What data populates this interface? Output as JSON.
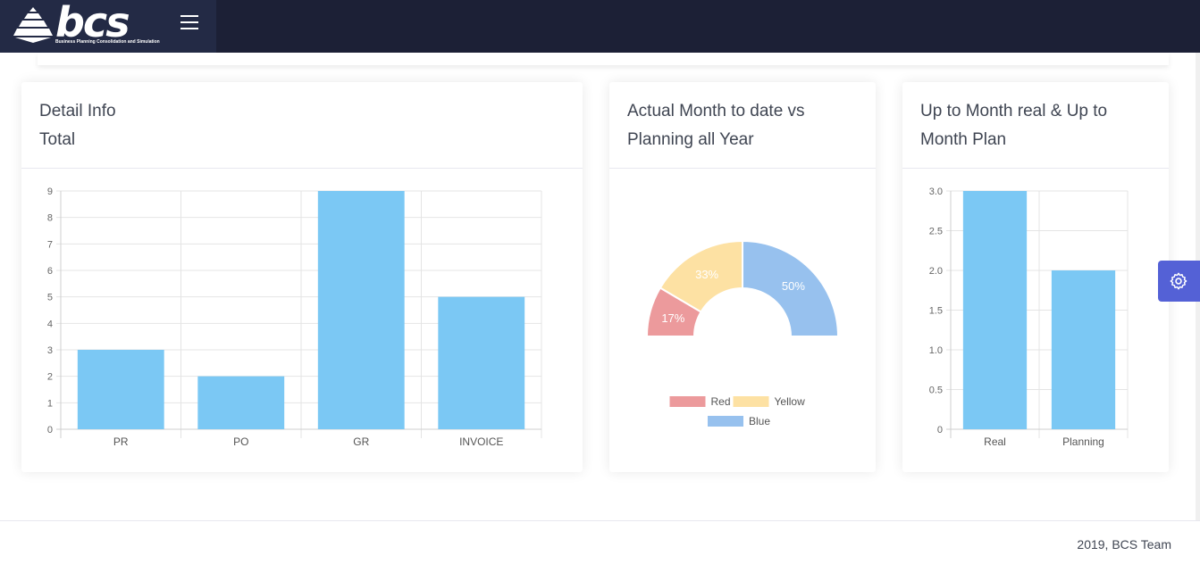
{
  "brand": {
    "name": "bcs",
    "tagline": "Business Planning Consolidation and Simulation"
  },
  "cards": {
    "detail": {
      "title_line1": "Detail Info",
      "title_line2": "Total"
    },
    "actual": {
      "title_line1": "Actual Month to date vs",
      "title_line2": "Planning all Year"
    },
    "upto": {
      "title_line1": "Up to Month real & Up to",
      "title_line2": "Month Plan"
    }
  },
  "footer": {
    "text": "2019, BCS Team"
  },
  "colors": {
    "topbar": "#1c2036",
    "bar": "#7bc8f4",
    "red": "#ec9a9c",
    "yellow": "#fde1a3",
    "blue": "#97c1ee",
    "settings": "#5461d6"
  },
  "icons": {
    "menu": "hamburger-icon",
    "settings": "gear-icon",
    "logo": "pyramid-logo"
  },
  "chart_data": [
    {
      "type": "bar",
      "categories": [
        "PR",
        "PO",
        "GR",
        "INVOICE"
      ],
      "values": [
        3,
        2,
        9,
        5
      ],
      "ylim": [
        0,
        9
      ],
      "yticks": [
        "0",
        "1",
        "2",
        "3",
        "4",
        "5",
        "6",
        "7",
        "8",
        "9"
      ],
      "grid": true,
      "legend": "none"
    },
    {
      "type": "pie",
      "variant": "half-doughnut",
      "labels": [
        "Red",
        "Yellow",
        "Blue"
      ],
      "values": [
        17,
        33,
        50
      ],
      "value_labels": [
        "17%",
        "33%",
        "50%"
      ],
      "colors": [
        "#ec9a9c",
        "#fde1a3",
        "#97c1ee"
      ],
      "legend": "bottom"
    },
    {
      "type": "bar",
      "categories": [
        "Real",
        "Planning"
      ],
      "values": [
        3.0,
        2.0
      ],
      "ylim": [
        0,
        3
      ],
      "yticks": [
        "0",
        "0.5",
        "1.0",
        "1.5",
        "2.0",
        "2.5",
        "3.0"
      ],
      "grid": true,
      "legend": "none"
    }
  ]
}
